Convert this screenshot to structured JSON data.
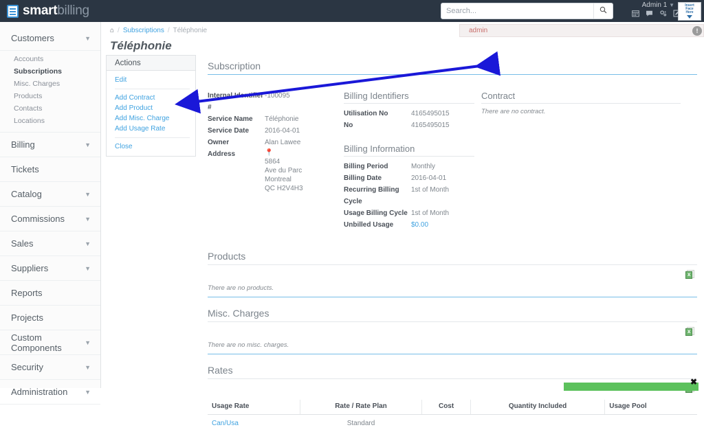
{
  "app": {
    "logo_primary": "smart",
    "logo_secondary": "billing",
    "accent_blue": "#3fa2e0",
    "topbar_bg": "#2b3643",
    "success_green": "#5cc15c",
    "annotation_color": "#1a18d8"
  },
  "header": {
    "search_placeholder": "Search...",
    "search_value": "",
    "search_icon": "search-icon",
    "user_label": "Admin 1",
    "icons": [
      "calendar-icon",
      "chat-icon",
      "settings-gear-icon",
      "edit-icon"
    ],
    "avatar_placeholder_line1": "Insert",
    "avatar_placeholder_line2": "Face",
    "avatar_placeholder_line3": "Here"
  },
  "alert": {
    "text": "admin",
    "close_label": "!"
  },
  "breadcrumb": {
    "home_icon": "home-icon",
    "items": [
      {
        "label": "Subscriptions",
        "link": true
      },
      {
        "label": "Téléphonie",
        "link": false
      }
    ],
    "separator": "/"
  },
  "page": {
    "title": "Téléphonie"
  },
  "sidebar": {
    "groups": [
      {
        "label": "Customers",
        "expandable": true,
        "expanded": true,
        "children": [
          {
            "label": "Accounts",
            "active": false
          },
          {
            "label": "Subscriptions",
            "active": true
          },
          {
            "label": "Misc. Charges",
            "active": false
          },
          {
            "label": "Products",
            "active": false
          },
          {
            "label": "Contacts",
            "active": false
          },
          {
            "label": "Locations",
            "active": false
          }
        ]
      },
      {
        "label": "Billing",
        "expandable": true,
        "expanded": false,
        "children": []
      },
      {
        "label": "Tickets",
        "expandable": false,
        "expanded": false,
        "children": []
      },
      {
        "label": "Catalog",
        "expandable": true,
        "expanded": false,
        "children": []
      },
      {
        "label": "Commissions",
        "expandable": true,
        "expanded": false,
        "children": []
      },
      {
        "label": "Sales",
        "expandable": true,
        "expanded": false,
        "children": []
      },
      {
        "label": "Suppliers",
        "expandable": true,
        "expanded": false,
        "children": []
      },
      {
        "label": "Reports",
        "expandable": false,
        "expanded": false,
        "children": []
      },
      {
        "label": "Projects",
        "expandable": false,
        "expanded": false,
        "children": []
      },
      {
        "label": "Custom Components",
        "expandable": true,
        "expanded": false,
        "children": []
      },
      {
        "label": "Security",
        "expandable": true,
        "expanded": false,
        "children": []
      },
      {
        "label": "Administration",
        "expandable": true,
        "expanded": false,
        "children": []
      }
    ]
  },
  "actions_panel": {
    "title": "Actions",
    "groups": [
      [
        "Edit"
      ],
      [
        "Add Contract",
        "Add Product",
        "Add Misc. Charge",
        "Add Usage Rate"
      ],
      [
        "Close"
      ]
    ]
  },
  "subscription": {
    "section_title": "Subscription",
    "details": [
      {
        "label": "Internal Identifier #",
        "value": "-100095"
      },
      {
        "label": "Service Name",
        "value": "Téléphonie"
      },
      {
        "label": "Service Date",
        "value": "2016-04-01"
      },
      {
        "label": "Owner",
        "value": "Alan Lawee"
      }
    ],
    "address_label": "Address",
    "address_icon": "map-pin-icon",
    "address_lines": [
      "5864",
      "Ave du Parc",
      "Montreal",
      "QC  H2V4H3"
    ]
  },
  "billing_identifiers": {
    "title": "Billing Identifiers",
    "rows": [
      {
        "label": "Utilisation No",
        "value": "4165495015"
      },
      {
        "label": "No",
        "value": "4165495015"
      }
    ]
  },
  "billing_information": {
    "title": "Billing Information",
    "rows": [
      {
        "label": "Billing Period",
        "value": "Monthly",
        "link": false
      },
      {
        "label": "Billing Date",
        "value": "2016-04-01",
        "link": false
      },
      {
        "label": "Recurring Billing Cycle",
        "value": "1st of Month",
        "link": false
      },
      {
        "label": "Usage Billing Cycle",
        "value": "1st of Month",
        "link": false
      },
      {
        "label": "Unbilled Usage",
        "value": "$0.00",
        "link": true
      }
    ]
  },
  "contract": {
    "title": "Contract",
    "empty_text": "There are no contract."
  },
  "products": {
    "title": "Products",
    "empty_text": "There are no products.",
    "export_icon": "excel-export-icon"
  },
  "misc_charges": {
    "title": "Misc. Charges",
    "empty_text": "There are no misc. charges.",
    "export_icon": "excel-export-icon"
  },
  "rates": {
    "title": "Rates",
    "export_icon": "excel-export-icon",
    "columns": [
      "Usage Rate",
      "Rate / Rate Plan",
      "Cost",
      "Quantity Included",
      "Usage Pool"
    ],
    "rows": [
      {
        "usage_rate": "Can/Usa",
        "rate_plan": "Standard",
        "cost": "",
        "quantity_included": "",
        "usage_pool": ""
      }
    ]
  },
  "toast": {
    "close_label": "✖"
  }
}
